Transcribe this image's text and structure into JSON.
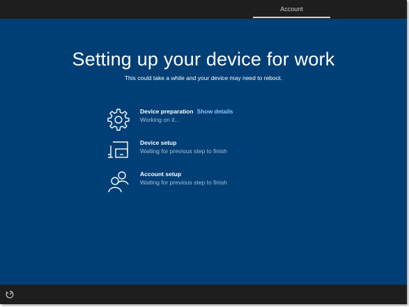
{
  "tabs": [
    {
      "label": "Account",
      "selected": true
    }
  ],
  "heading": {
    "title": "Setting up your device for work",
    "subtitle": "This could take a while and your device may need to reboot."
  },
  "steps": [
    {
      "title": "Device preparation",
      "link": "Show details",
      "status": "Working on it...",
      "icon": "gear-icon"
    },
    {
      "title": "Device setup",
      "status": "Waiting for previous step to finish",
      "icon": "device-icon"
    },
    {
      "title": "Account setup",
      "status": "Waiting for previous step to finish",
      "icon": "people-icon"
    }
  ],
  "bottom": {
    "icon": "ease-of-access-icon"
  },
  "colors": {
    "background": "#003f75",
    "chrome": "#1e1e1e",
    "text": "#ffffff",
    "secondary_text": "#a9bfd6",
    "link": "#8fc5ff"
  }
}
